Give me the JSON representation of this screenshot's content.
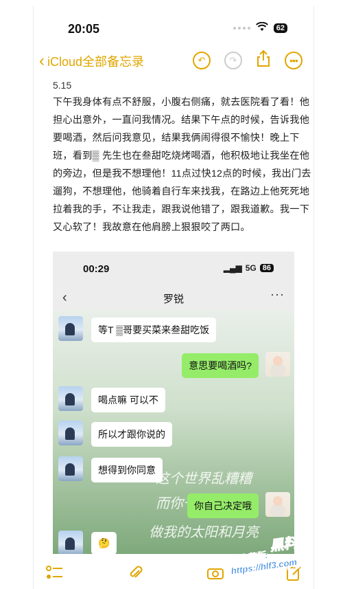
{
  "status_bar": {
    "time": "20:05",
    "battery": "62"
  },
  "nav": {
    "back_label": "iCloud全部备忘录"
  },
  "note": {
    "date": "5.15",
    "text": "下午我身体有点不舒服，小腹右侧痛，就去医院看了看！他担心出意外，一直问我情况。结果下午点的时候，告诉我他要喝酒，然后问我意见，结果我俩闹得很不愉快！晚上下班，看到▒ 先生也在叁甜吃烧烤喝酒，他积极地让我坐在他的旁边，但是我不想理他！11点过快12点的时候，我出门去遛狗，不想理他，他骑着自行车来找我，在路边上他死死地拉着我的手，不让我走，跟我说他错了，跟我道歉。我一下又心软了！我故意在他肩膀上狠狠咬了两口。"
  },
  "screenshot": {
    "time": "00:29",
    "network": "5G",
    "battery": "86",
    "chat_title": "罗锐",
    "messages": [
      {
        "side": "left",
        "text": "等T ▒哥要买菜来叁甜吃饭"
      },
      {
        "side": "right",
        "text": "意思要喝酒吗?"
      },
      {
        "side": "left",
        "text": "喝点嘛 可以不"
      },
      {
        "side": "left",
        "text": "所以才跟你说的"
      },
      {
        "side": "left",
        "text": "想得到你同意"
      },
      {
        "side": "right",
        "text": "你自己决定哦"
      },
      {
        "side": "left",
        "text": "🤔"
      }
    ],
    "handwriting": [
      "这个世界乱糟糟",
      "而你干干净净",
      "做我的太阳和月亮"
    ]
  },
  "watermark": {
    "line1": "黑料吃瓜网",
    "line2": "看完整版: https://hlf3.com"
  },
  "colors": {
    "accent": "#e0a600",
    "wechat_green": "#95ec69"
  }
}
